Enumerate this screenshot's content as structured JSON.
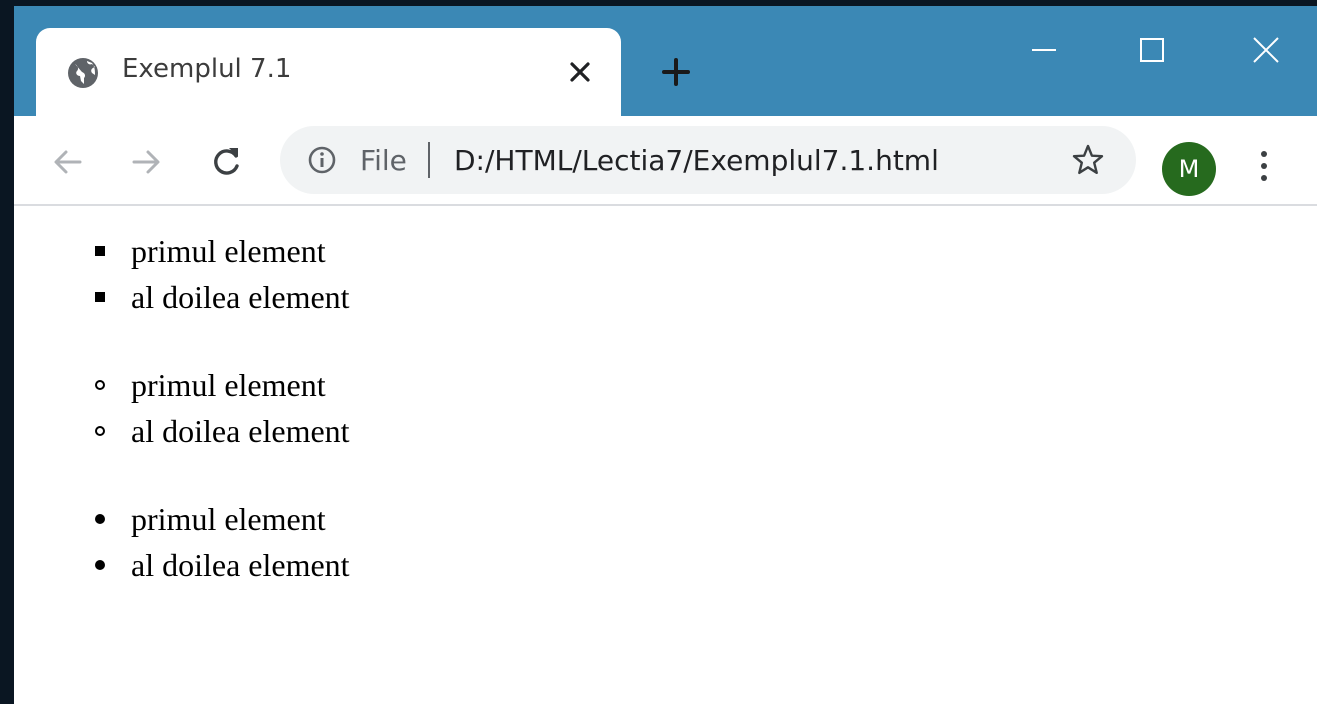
{
  "tab": {
    "title": "Exemplul 7.1",
    "favicon": "globe-icon"
  },
  "omnibox": {
    "scheme_label": "File",
    "url": "D:/HTML/Lectia7/Exemplul7.1.html"
  },
  "profile": {
    "initial": "M",
    "color": "#266a1e"
  },
  "colors": {
    "titlebar": "#3b88b5",
    "tab": "#ffffff"
  },
  "page": {
    "lists": [
      {
        "marker": "square",
        "items": [
          "primul element",
          "al doilea element"
        ]
      },
      {
        "marker": "circle",
        "items": [
          "primul element",
          "al doilea element"
        ]
      },
      {
        "marker": "disc",
        "items": [
          "primul element",
          "al doilea element"
        ]
      }
    ]
  }
}
